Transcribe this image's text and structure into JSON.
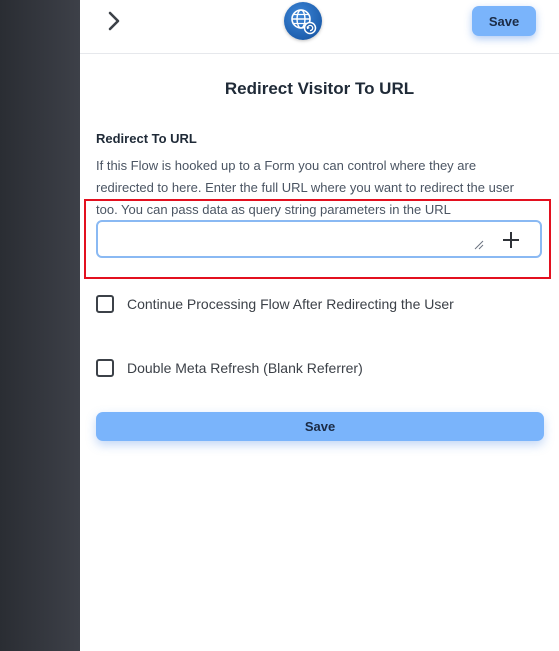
{
  "header": {
    "save_label": "Save",
    "back_icon": "chevron-right-icon",
    "app_icon": "globe-redirect-icon"
  },
  "panel": {
    "title": "Redirect Visitor To URL",
    "field_label": "Redirect To URL",
    "help_text": "If this Flow is hooked up to a Form you can control where they are redirected to here. Enter the full URL where you want to redirect the user too. You can pass data as query string parameters in the URL",
    "url_value": "",
    "options": [
      {
        "label": "Continue Processing Flow After Redirecting the User",
        "checked": false
      },
      {
        "label": "Double Meta Refresh (Blank Referrer)",
        "checked": false
      }
    ],
    "save_label": "Save"
  },
  "colors": {
    "accent": "#7ab4fb",
    "highlight": "#e3101f",
    "backdrop": "#2f3238"
  }
}
